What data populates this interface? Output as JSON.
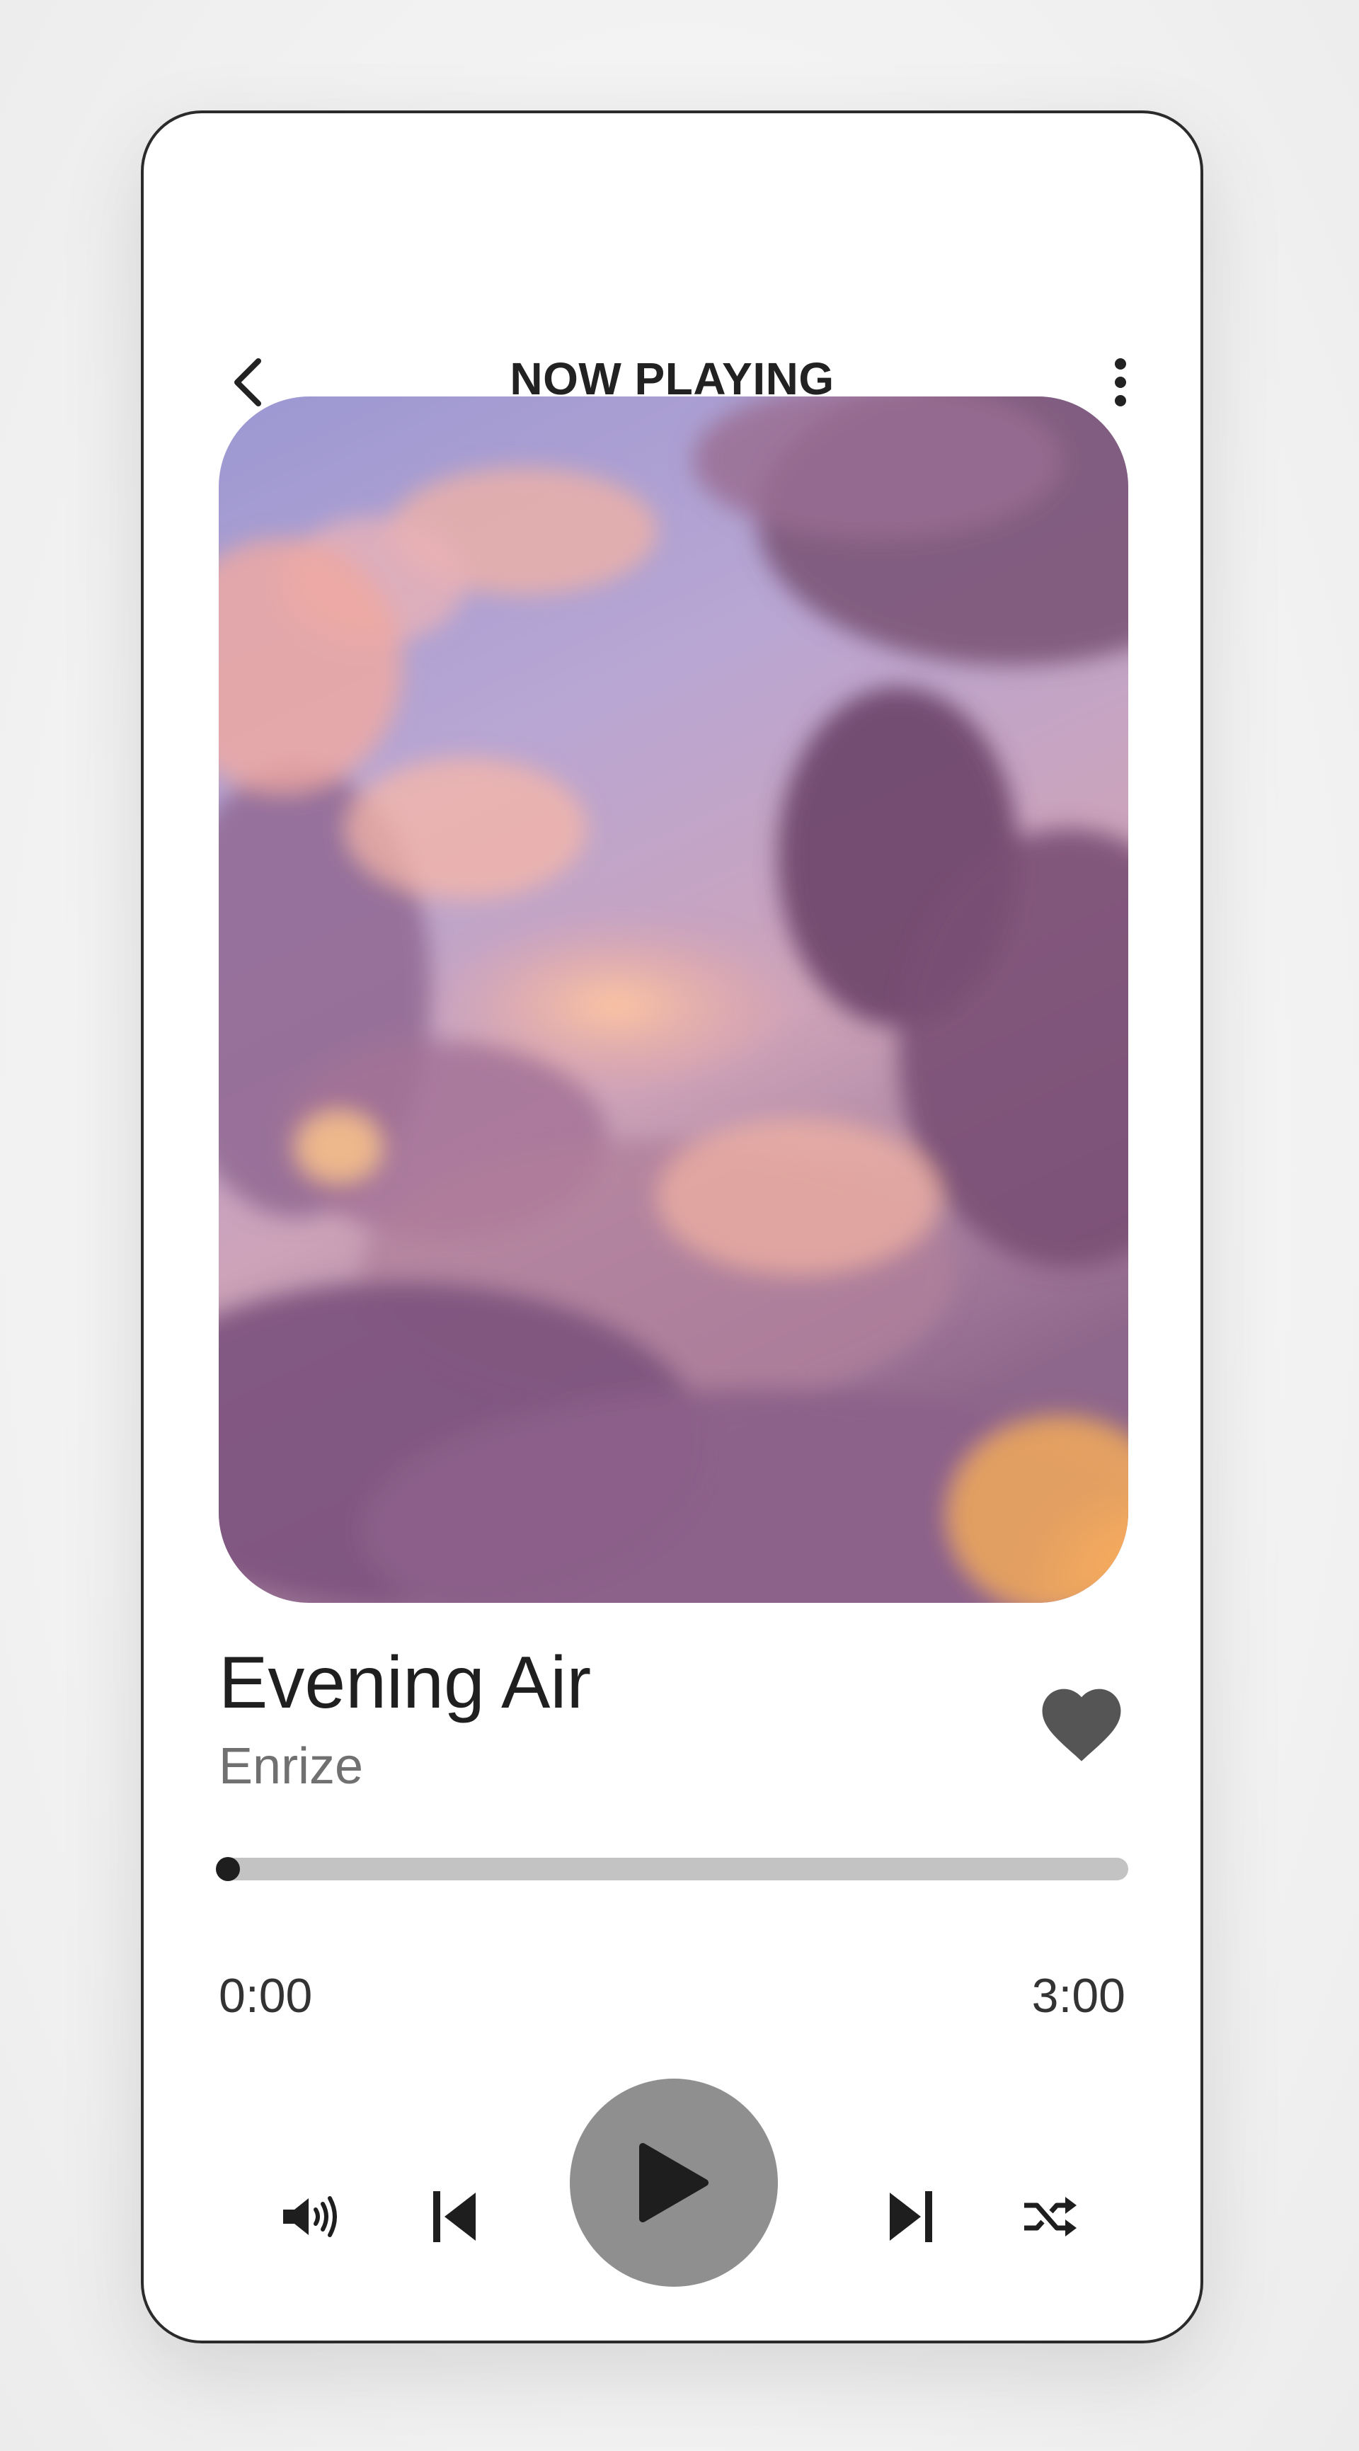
{
  "header": {
    "title": "NOW PLAYING",
    "back_icon": "chevron-left-icon",
    "menu_icon": "more-vertical-icon"
  },
  "artwork": {
    "description_icon": "album-art-image",
    "palette": [
      "#9d9ad3",
      "#c2a0cb",
      "#f5b49a",
      "#6f4a6e",
      "#ffb15a"
    ]
  },
  "track": {
    "title": "Evening Air",
    "artist": "Enrize",
    "liked": true,
    "like_icon": "heart-icon"
  },
  "progress": {
    "current_time": "0:00",
    "total_time": "3:00",
    "fraction": 0
  },
  "controls": {
    "volume_icon": "volume-icon",
    "previous_icon": "skip-previous-icon",
    "play_icon": "play-icon",
    "next_icon": "skip-next-icon",
    "shuffle_icon": "shuffle-icon"
  },
  "colors": {
    "card_background": "#ffffff",
    "text_primary": "#1f1f1f",
    "text_secondary": "#707070",
    "progress_track": "#c3c3c3",
    "progress_fill": "#2a2a2a",
    "heart": "#555555",
    "play_button": "#8f8f8f",
    "icon": "#1e1e1e"
  }
}
